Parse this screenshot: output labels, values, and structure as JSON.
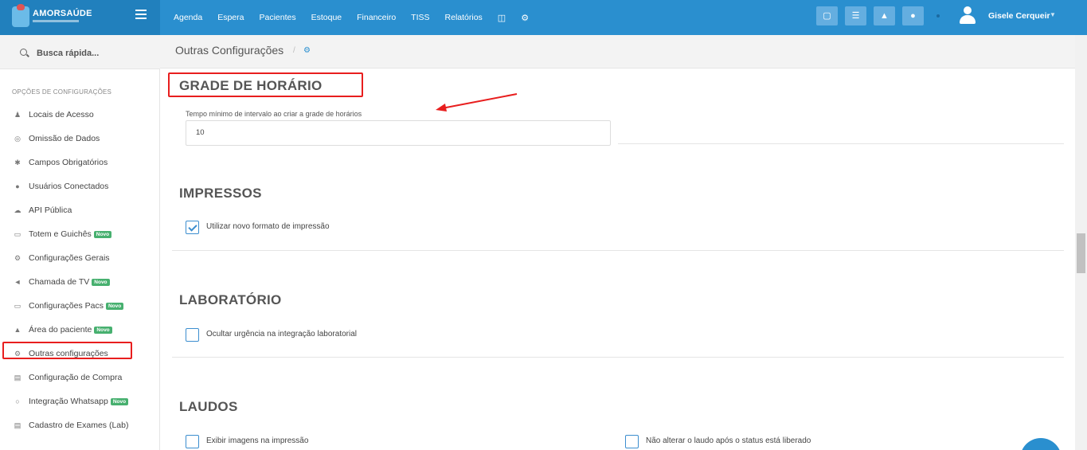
{
  "brand": {
    "name": "AMORSAÚDE"
  },
  "topnav": {
    "items": [
      "Agenda",
      "Espera",
      "Pacientes",
      "Estoque",
      "Financeiro",
      "TISS",
      "Relatórios"
    ]
  },
  "user": {
    "name": "Gisele Cerqueir"
  },
  "search": {
    "label": "Busca rápida..."
  },
  "sidebar": {
    "heading": "OPÇÕES DE CONFIGURAÇÕES",
    "items": [
      {
        "label": "Locais de Acesso",
        "icon": "person-icon",
        "badge": ""
      },
      {
        "label": "Omissão de Dados",
        "icon": "eye-slash-icon",
        "badge": ""
      },
      {
        "label": "Campos Obrigatórios",
        "icon": "asterisk-icon",
        "badge": ""
      },
      {
        "label": "Usuários Conectados",
        "icon": "user-icon",
        "badge": ""
      },
      {
        "label": "API Pública",
        "icon": "cloud-icon",
        "badge": ""
      },
      {
        "label": "Totem e Guichês",
        "icon": "laptop-icon",
        "badge": "Novo"
      },
      {
        "label": "Configurações Gerais",
        "icon": "gears-icon",
        "badge": ""
      },
      {
        "label": "Chamada de TV",
        "icon": "megaphone-icon",
        "badge": "Novo"
      },
      {
        "label": "Configurações Pacs",
        "icon": "laptop-icon",
        "badge": "Novo"
      },
      {
        "label": "Área do paciente",
        "icon": "flask-icon",
        "badge": "Novo"
      },
      {
        "label": "Outras configurações",
        "icon": "gears-icon",
        "badge": ""
      },
      {
        "label": "Configuração de Compra",
        "icon": "cart-icon",
        "badge": ""
      },
      {
        "label": "Integração Whatsapp",
        "icon": "whatsapp-icon",
        "badge": "Novo"
      },
      {
        "label": "Cadastro de Exames (Lab)",
        "icon": "cart-icon",
        "badge": ""
      }
    ]
  },
  "breadcrumb": {
    "title": "Outras Configurações",
    "separator": "/"
  },
  "main": {
    "grade": {
      "title": "GRADE DE HORÁRIO",
      "field_label": "Tempo mínimo de intervalo ao criar a grade de horários",
      "field_value": "10"
    },
    "impressos": {
      "title": "IMPRESSOS",
      "option_label": "Utilizar novo formato de impressão",
      "checked": true
    },
    "laboratorio": {
      "title": "LABORATÓRIO",
      "option_label": "Ocultar urgência na integração laboratorial",
      "checked": false
    },
    "laudos": {
      "title": "LAUDOS",
      "option1_label": "Exibir imagens na impressão",
      "option2_label": "Não alterar o laudo após o status está liberado"
    }
  },
  "colors": {
    "topbar": "#2a8fcf",
    "accent": "#3c8ecf",
    "highlight": "#e81e1e",
    "badge": "#47b06f"
  }
}
